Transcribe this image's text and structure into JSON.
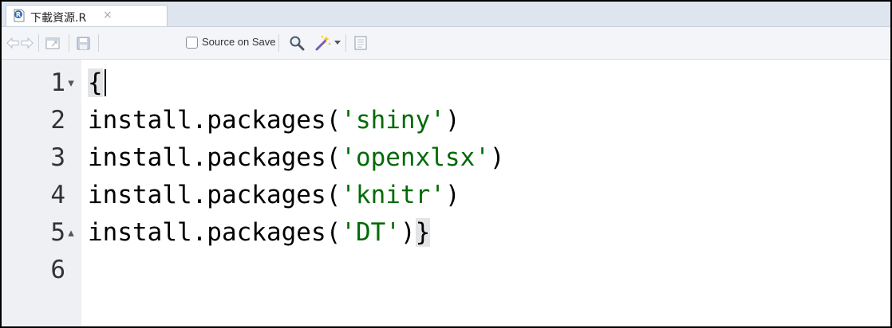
{
  "tab": {
    "title": "下載資源.R",
    "close": "×",
    "icon": "r-file-icon"
  },
  "toolbar": {
    "back_icon": "back-arrow-icon",
    "forward_icon": "forward-arrow-icon",
    "source_on_save": {
      "label": "Source on Save",
      "checked": false
    },
    "search_icon": "search-icon",
    "wand_icon": "magic-wand-icon",
    "outline_icon": "document-outline-icon"
  },
  "editor": {
    "lines": [
      {
        "num": "1",
        "fold": "▾",
        "parts": [
          "{",
          "",
          "",
          ""
        ]
      },
      {
        "num": "2",
        "fold": "",
        "parts": [
          "install.packages(",
          "'shiny'",
          ")",
          ""
        ]
      },
      {
        "num": "3",
        "fold": "",
        "parts": [
          "install.packages(",
          "'openxlsx'",
          ")",
          ""
        ]
      },
      {
        "num": "4",
        "fold": "",
        "parts": [
          "install.packages(",
          "'knitr'",
          ")",
          ""
        ]
      },
      {
        "num": "5",
        "fold": "▴",
        "parts": [
          "install.packages(",
          "'DT'",
          ")",
          "}"
        ]
      },
      {
        "num": "6",
        "fold": "",
        "parts": [
          "",
          "",
          "",
          ""
        ]
      }
    ]
  },
  "colors": {
    "string": "#036a07",
    "gutter": "#eef0f3",
    "tabbar": "#dfe5ee"
  }
}
